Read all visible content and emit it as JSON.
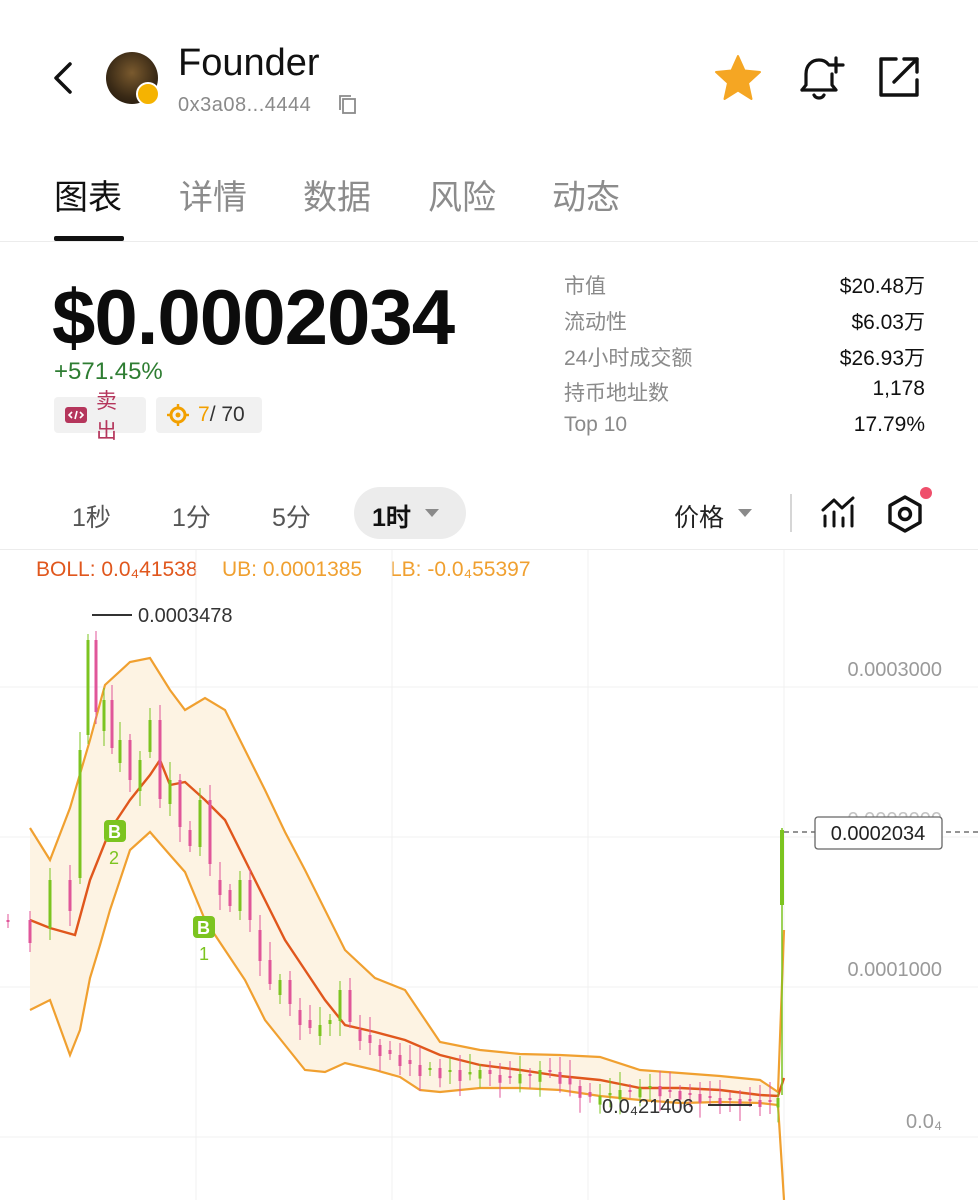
{
  "header": {
    "token_name": "Founder",
    "address": "0x3a08...4444",
    "icons": [
      "back-arrow-icon",
      "copy-icon",
      "star-icon",
      "bell-plus-icon",
      "share-icon"
    ],
    "star_color": "#f5a623"
  },
  "tabs": [
    {
      "label": "图表",
      "active": true
    },
    {
      "label": "详情",
      "active": false
    },
    {
      "label": "数据",
      "active": false
    },
    {
      "label": "风险",
      "active": false
    },
    {
      "label": "动态",
      "active": false
    }
  ],
  "price_block": {
    "price": "$0.0002034",
    "change": "+571.45%",
    "sell_label": "卖出",
    "score_value": "7",
    "score_total": " / 70",
    "colors": {
      "positive": "#2e7d32",
      "sell": "#b5365c",
      "score": "#f2a000"
    }
  },
  "stats": [
    {
      "label": "市值",
      "value": "$20.48万"
    },
    {
      "label": "流动性",
      "value": "$6.03万"
    },
    {
      "label": "24小时成交额",
      "value": "$26.93万"
    },
    {
      "label": "持币地址数",
      "value": "1,178"
    },
    {
      "label": "Top 10",
      "value": "17.79%"
    }
  ],
  "timeframes": {
    "items": [
      "1秒",
      "1分",
      "5分"
    ],
    "active": "1时",
    "price_mode": "价格"
  },
  "indicator": {
    "boll": "BOLL: 0.0₄41538",
    "ub": "UB: 0.0001385",
    "lb": "LB: -0.0₄55397"
  },
  "chart_data": {
    "type": "candlestick",
    "title": "",
    "y_ticks": [
      "0.0003000",
      "0.0002000",
      "0.0001000",
      "0.0₄"
    ],
    "current_price_label": "0.0002034",
    "high_marker": "0.0003478",
    "low_marker": "0.0₄21406",
    "buy_markers": [
      {
        "letter": "B",
        "count": "2"
      },
      {
        "letter": "B",
        "count": "1"
      }
    ],
    "colors": {
      "up": "#7cc420",
      "down": "#e0569a",
      "mid_band": "#e0571d",
      "bands": "#f0a030",
      "band_fill": "#fdf3e3"
    }
  }
}
